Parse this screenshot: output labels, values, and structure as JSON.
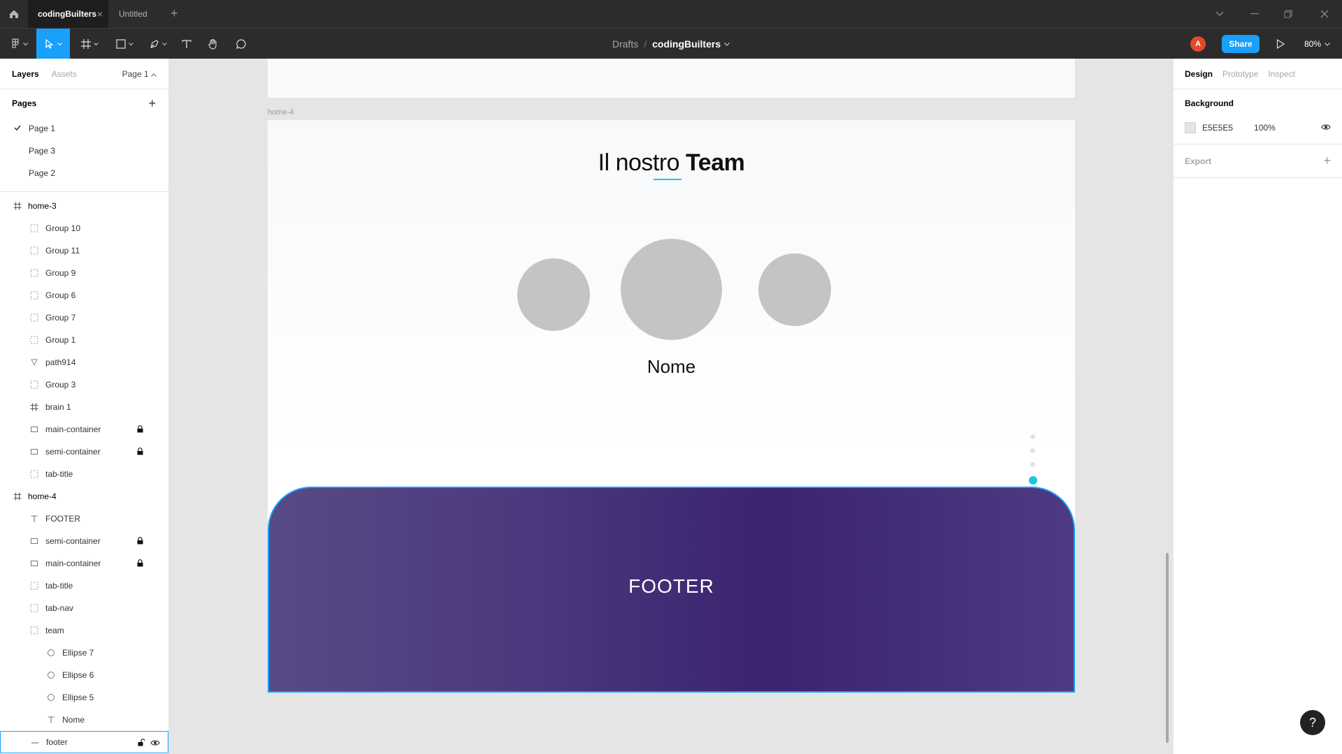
{
  "titlebar": {
    "tabs": [
      {
        "label": "codingBuilters",
        "close": "×"
      },
      {
        "label": "Untitled"
      }
    ],
    "add_tab": "+"
  },
  "toolbar": {
    "breadcrumb_parent": "Drafts",
    "breadcrumb_sep": "/",
    "file_name": "codingBuilters",
    "avatar_letter": "A",
    "share_label": "Share",
    "zoom": "80%"
  },
  "left_panel": {
    "tabs": [
      "Layers",
      "Assets"
    ],
    "current_page": "Page 1",
    "pages_title": "Pages",
    "pages_add": "+",
    "pages": [
      "Page 1",
      "Page 3",
      "Page 2"
    ],
    "layers": [
      {
        "name": "home-3",
        "level": 0,
        "icon": "frame-icon"
      },
      {
        "name": "Group 10",
        "level": 1,
        "icon": "group-icon"
      },
      {
        "name": "Group 11",
        "level": 1,
        "icon": "group-icon"
      },
      {
        "name": "Group 9",
        "level": 1,
        "icon": "group-icon"
      },
      {
        "name": "Group 6",
        "level": 1,
        "icon": "group-icon"
      },
      {
        "name": "Group 7",
        "level": 1,
        "icon": "group-icon"
      },
      {
        "name": "Group 1",
        "level": 1,
        "icon": "group-icon"
      },
      {
        "name": "path914",
        "level": 1,
        "icon": "vector-icon"
      },
      {
        "name": "Group 3",
        "level": 1,
        "icon": "group-icon"
      },
      {
        "name": "brain 1",
        "level": 1,
        "icon": "frame-icon"
      },
      {
        "name": "main-container",
        "level": 1,
        "icon": "rectangle-icon",
        "locked": true
      },
      {
        "name": "semi-container",
        "level": 1,
        "icon": "rectangle-icon",
        "locked": true
      },
      {
        "name": "tab-title",
        "level": 1,
        "icon": "group-icon"
      },
      {
        "name": "home-4",
        "level": 0,
        "icon": "frame-icon"
      },
      {
        "name": "FOOTER",
        "level": 1,
        "icon": "text-icon"
      },
      {
        "name": "semi-container",
        "level": 1,
        "icon": "rectangle-icon",
        "locked": true
      },
      {
        "name": "main-container",
        "level": 1,
        "icon": "rectangle-icon",
        "locked": true
      },
      {
        "name": "tab-title",
        "level": 1,
        "icon": "group-icon"
      },
      {
        "name": "tab-nav",
        "level": 1,
        "icon": "group-icon"
      },
      {
        "name": "team",
        "level": 1,
        "icon": "group-icon"
      },
      {
        "name": "Ellipse 7",
        "level": 2,
        "icon": "ellipse-icon"
      },
      {
        "name": "Ellipse 6",
        "level": 2,
        "icon": "ellipse-icon"
      },
      {
        "name": "Ellipse 5",
        "level": 2,
        "icon": "ellipse-icon"
      },
      {
        "name": "Nome",
        "level": 2,
        "icon": "text-icon"
      },
      {
        "name": "footer",
        "level": 1,
        "icon": "line-icon",
        "selected": true
      }
    ]
  },
  "canvas": {
    "frame_label": "home-4",
    "team_title_light": "Il nostro",
    "team_title_bold": "Team",
    "member_name": "Nome",
    "footer_text": "FOOTER",
    "accent_color": "#18c6e6",
    "footer_gradient": [
      "#574a85",
      "#3c2370",
      "#4e3a82"
    ]
  },
  "right_panel": {
    "tabs": [
      "Design",
      "Prototype",
      "Inspect"
    ],
    "background_title": "Background",
    "background_hex": "E5E5E5",
    "background_opacity": "100%",
    "export_title": "Export",
    "export_add": "+"
  },
  "help_label": "?",
  "colors": {
    "brand_blue": "#18a0fb",
    "avatar": "#e24a2b",
    "toolbar_bg": "#2c2c2c"
  }
}
